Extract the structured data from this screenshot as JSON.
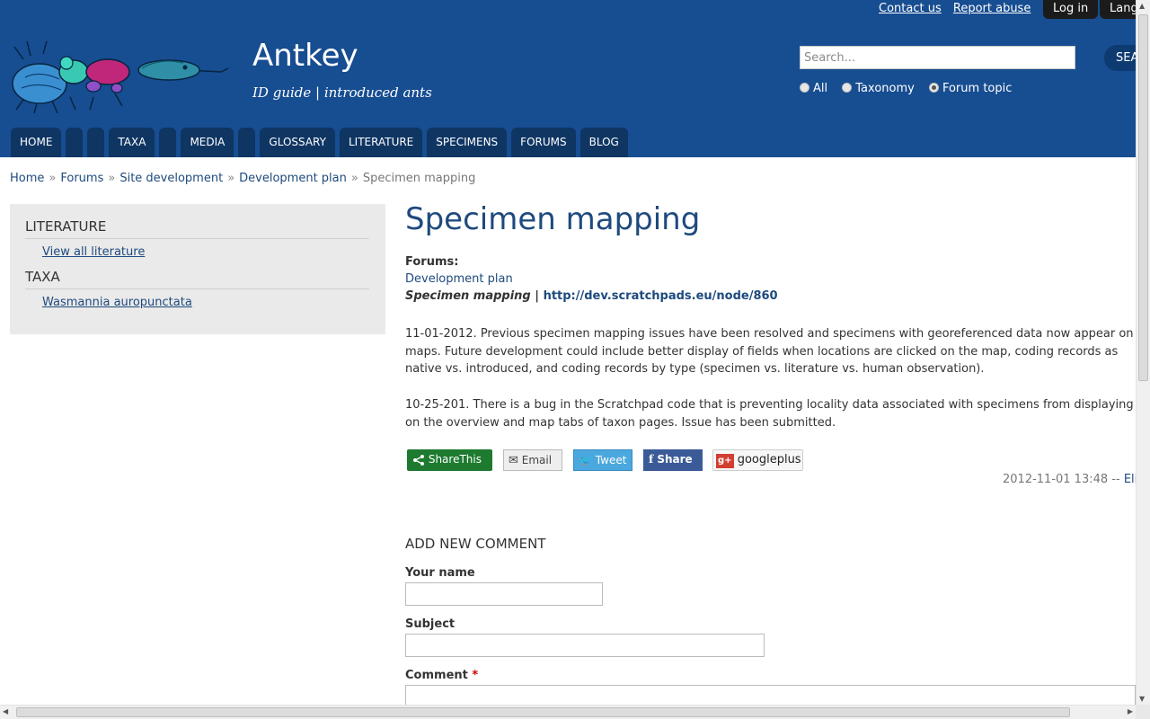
{
  "header": {
    "site_name": "Antkey",
    "slogan": "ID guide | introduced ants",
    "top_links": [
      "Contact us",
      "Report abuse"
    ],
    "login_label": "Log in",
    "language_label": "Lang",
    "search": {
      "placeholder": "Search...",
      "button_label": "SEA"
    },
    "search_scope": {
      "options": [
        "All",
        "Taxonomy",
        "Forum topic"
      ],
      "selected": "Forum topic"
    },
    "colors": {
      "header_bg": "#174d91",
      "nav_tab_bg": "#0f3563",
      "accent_link": "#1e4a7e"
    }
  },
  "nav": {
    "tabs": [
      {
        "label": "HOME"
      },
      {
        "label": ""
      },
      {
        "label": ""
      },
      {
        "label": "TAXA"
      },
      {
        "label": ""
      },
      {
        "label": "MEDIA"
      },
      {
        "label": ""
      },
      {
        "label": "GLOSSARY"
      },
      {
        "label": "LITERATURE"
      },
      {
        "label": "SPECIMENS"
      },
      {
        "label": "FORUMS"
      },
      {
        "label": "BLOG"
      }
    ]
  },
  "breadcrumb": {
    "items": [
      "Home",
      "Forums",
      "Site development",
      "Development plan"
    ],
    "separator": "»",
    "current": "Specimen mapping"
  },
  "sidebar": {
    "blocks": [
      {
        "heading": "LITERATURE",
        "links": [
          "View all literature"
        ]
      },
      {
        "heading": "TAXA",
        "links": [
          "Wasmannia auropunctata"
        ]
      }
    ]
  },
  "content": {
    "title": "Specimen mapping",
    "forums_label": "Forums:",
    "forum_link": "Development plan",
    "subject_italic": "Specimen mapping",
    "subject_sep": "|",
    "subject_url": "http://dev.scratchpads.eu/node/860",
    "paragraphs": [
      "11-01-2012. Previous specimen mapping issues have been resolved and specimens with georeferenced data now appear on maps. Future development could include better display of fields when locations are clicked on the map, coding records as native vs. introduced, and coding records by type (specimen vs. literature vs. human observation).",
      "10-25-201. There is a bug in the Scratchpad code that is preventing locality data associated with specimens from displaying on the overview and map tabs of taxon pages. Issue has been submitted."
    ],
    "share_buttons": [
      "ShareThis",
      "Email",
      "Tweet",
      "Share",
      "googleplus"
    ],
    "submitted": {
      "date": "2012-11-01 13:48",
      "sep": "--",
      "author": "Eli"
    }
  },
  "comment_form": {
    "heading": "ADD NEW COMMENT",
    "name_label": "Your name",
    "subject_label": "Subject",
    "comment_label": "Comment",
    "required_mark": "*"
  }
}
